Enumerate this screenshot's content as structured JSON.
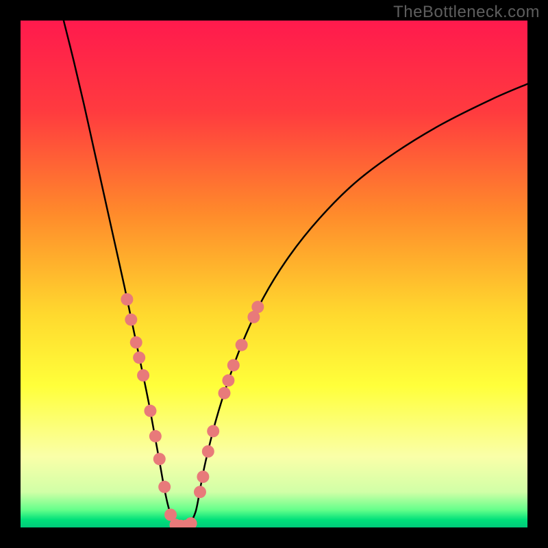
{
  "watermark": "TheBottleneck.com",
  "chart_data": {
    "type": "line",
    "title": "",
    "xlabel": "",
    "ylabel": "",
    "xlim": [
      0,
      100
    ],
    "ylim": [
      0,
      100
    ],
    "background_gradient": {
      "stops": [
        {
          "offset": 0.0,
          "color": "#ff1a4d"
        },
        {
          "offset": 0.18,
          "color": "#ff3b3f"
        },
        {
          "offset": 0.38,
          "color": "#ff8a2b"
        },
        {
          "offset": 0.58,
          "color": "#ffd92e"
        },
        {
          "offset": 0.72,
          "color": "#ffff3a"
        },
        {
          "offset": 0.86,
          "color": "#faffa8"
        },
        {
          "offset": 0.93,
          "color": "#d1ffa7"
        },
        {
          "offset": 0.965,
          "color": "#66ff8b"
        },
        {
          "offset": 0.985,
          "color": "#00e07a"
        },
        {
          "offset": 1.0,
          "color": "#00c97a"
        }
      ]
    },
    "series": [
      {
        "name": "bottleneck-curve",
        "x": [
          8.5,
          10.5,
          12.5,
          14.5,
          16.5,
          18.5,
          20.5,
          22.5,
          24.5,
          25.5,
          26.5,
          27.5,
          28.5,
          29.5,
          31,
          33,
          34.5,
          35.5,
          36.5,
          38.5,
          41,
          44,
          48,
          53,
          59,
          66,
          74,
          83,
          93,
          100
        ],
        "y": [
          100,
          92,
          83.5,
          74.5,
          65.5,
          56.5,
          47.5,
          38,
          28.5,
          23.5,
          18,
          12.5,
          7,
          3,
          0.5,
          0.5,
          3,
          8,
          13,
          21,
          29,
          37,
          45.5,
          53.5,
          61,
          68,
          74,
          79.5,
          84.5,
          87.5
        ]
      }
    ],
    "markers": {
      "name": "highlight-dots",
      "color": "#e87a7a",
      "radius": 9,
      "points": [
        {
          "x": 21.0,
          "y": 45.0
        },
        {
          "x": 21.8,
          "y": 41.0
        },
        {
          "x": 22.8,
          "y": 36.5
        },
        {
          "x": 23.4,
          "y": 33.5
        },
        {
          "x": 24.2,
          "y": 30.0
        },
        {
          "x": 25.6,
          "y": 23.0
        },
        {
          "x": 26.6,
          "y": 18.0
        },
        {
          "x": 27.4,
          "y": 13.5
        },
        {
          "x": 28.4,
          "y": 8.0
        },
        {
          "x": 29.6,
          "y": 2.5
        },
        {
          "x": 30.6,
          "y": 0.5
        },
        {
          "x": 31.6,
          "y": 0.3
        },
        {
          "x": 32.6,
          "y": 0.3
        },
        {
          "x": 33.6,
          "y": 0.8
        },
        {
          "x": 35.4,
          "y": 7.0
        },
        {
          "x": 36.0,
          "y": 10.0
        },
        {
          "x": 37.0,
          "y": 15.0
        },
        {
          "x": 38.0,
          "y": 19.0
        },
        {
          "x": 40.2,
          "y": 26.5
        },
        {
          "x": 41.0,
          "y": 29.0
        },
        {
          "x": 42.0,
          "y": 32.0
        },
        {
          "x": 43.6,
          "y": 36.0
        },
        {
          "x": 46.0,
          "y": 41.5
        },
        {
          "x": 46.8,
          "y": 43.5
        }
      ]
    }
  }
}
